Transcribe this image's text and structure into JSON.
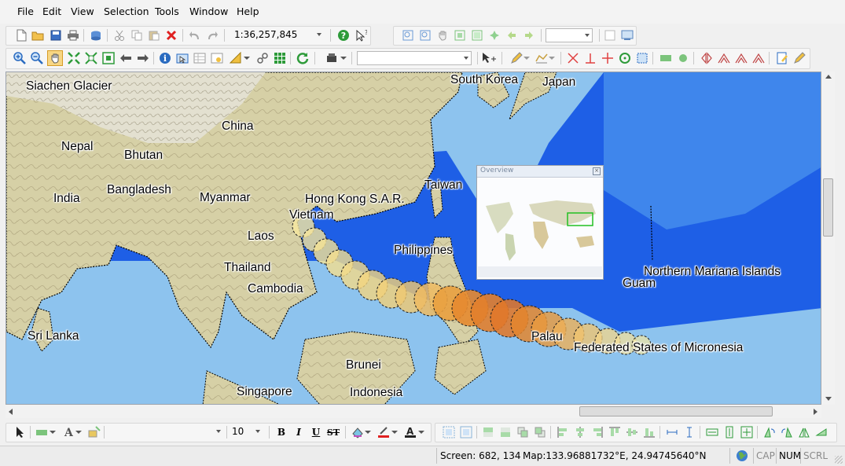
{
  "menu": [
    "File",
    "Edit",
    "View",
    "Selection",
    "Tools",
    "Window",
    "Help"
  ],
  "toolbar": {
    "scale_value": "1:36,257,845",
    "zoom_value": "",
    "layer_value": "",
    "font_size_value": "10",
    "font_name_value": ""
  },
  "map": {
    "labels": [
      {
        "id": "siachen",
        "text": "Siachen Glacier"
      },
      {
        "id": "south-korea",
        "text": "South Korea"
      },
      {
        "id": "japan",
        "text": "Japan"
      },
      {
        "id": "china",
        "text": "China"
      },
      {
        "id": "nepal",
        "text": "Nepal"
      },
      {
        "id": "bhutan",
        "text": "Bhutan"
      },
      {
        "id": "india",
        "text": "India"
      },
      {
        "id": "bangladesh",
        "text": "Bangladesh"
      },
      {
        "id": "myanmar",
        "text": "Myanmar"
      },
      {
        "id": "hongkong",
        "text": "Hong Kong S.A.R."
      },
      {
        "id": "taiwan",
        "text": "Taiwan"
      },
      {
        "id": "vietnam",
        "text": "Vietnam"
      },
      {
        "id": "laos",
        "text": "Laos"
      },
      {
        "id": "philippines",
        "text": "Philippines"
      },
      {
        "id": "thailand",
        "text": "Thailand"
      },
      {
        "id": "cambodia",
        "text": "Cambodia"
      },
      {
        "id": "nmi",
        "text": "Northern Mariana Islands"
      },
      {
        "id": "guam",
        "text": "Guam"
      },
      {
        "id": "srilanka",
        "text": "Sri Lanka"
      },
      {
        "id": "palau",
        "text": "Palau"
      },
      {
        "id": "fsm",
        "text": "Federated States of Micronesia"
      },
      {
        "id": "brunei",
        "text": "Brunei"
      },
      {
        "id": "singapore",
        "text": "Singapore"
      },
      {
        "id": "indonesia",
        "text": "Indonesia"
      }
    ],
    "overview_title": "Overview"
  },
  "status": {
    "screen": "Screen: 682, 134",
    "map_coords": "Map:133.96881732°E, 24.94745640°N",
    "cap": "CAP",
    "num": "NUM",
    "scrl": "SCRL"
  },
  "colors": {
    "ocean_deep": "#1e5fe6",
    "ocean_shelf": "#8dc3ee",
    "land": "#d9d4a8",
    "track_light": "#f7e8a0",
    "track_dark": "#e0782a"
  }
}
